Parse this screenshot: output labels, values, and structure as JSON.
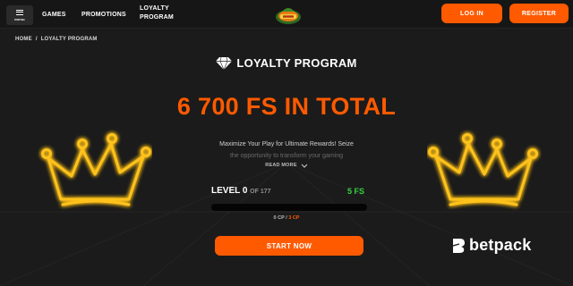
{
  "header": {
    "menu_label": "menu",
    "nav": [
      "GAMES",
      "PROMOTIONS",
      "LOYALTY PROGRAM"
    ],
    "login_label": "LOG IN",
    "register_label": "REGISTER"
  },
  "breadcrumb": {
    "home": "HOME",
    "separator": "/",
    "current": "LOYALTY PROGRAM"
  },
  "page": {
    "title": "LOYALTY PROGRAM",
    "total": "6 700 FS IN TOTAL",
    "description_line1": "Maximize Your Play for Ultimate Rewards! Seize",
    "description_line2": "the opportunity to transform your gaming",
    "read_more": "READ MORE",
    "level_label": "LEVEL 0",
    "level_of": "OF 177",
    "level_reward": "5 FS",
    "progress": 0,
    "cp_current": "0 CP",
    "cp_separator": "/",
    "cp_required": "3 CP",
    "start_label": "START NOW"
  },
  "watermark": {
    "text": "betpack"
  },
  "colors": {
    "accent": "#ff5a00",
    "reward_green": "#36d13e",
    "background": "#1b1b1b",
    "crown_glow": "#ffc21a"
  },
  "icons": {
    "menu": "hamburger-icon",
    "logo": "casino-logo",
    "title": "diamond-icon",
    "read_more": "chevron-down-icon",
    "decor": "crown-icon"
  }
}
